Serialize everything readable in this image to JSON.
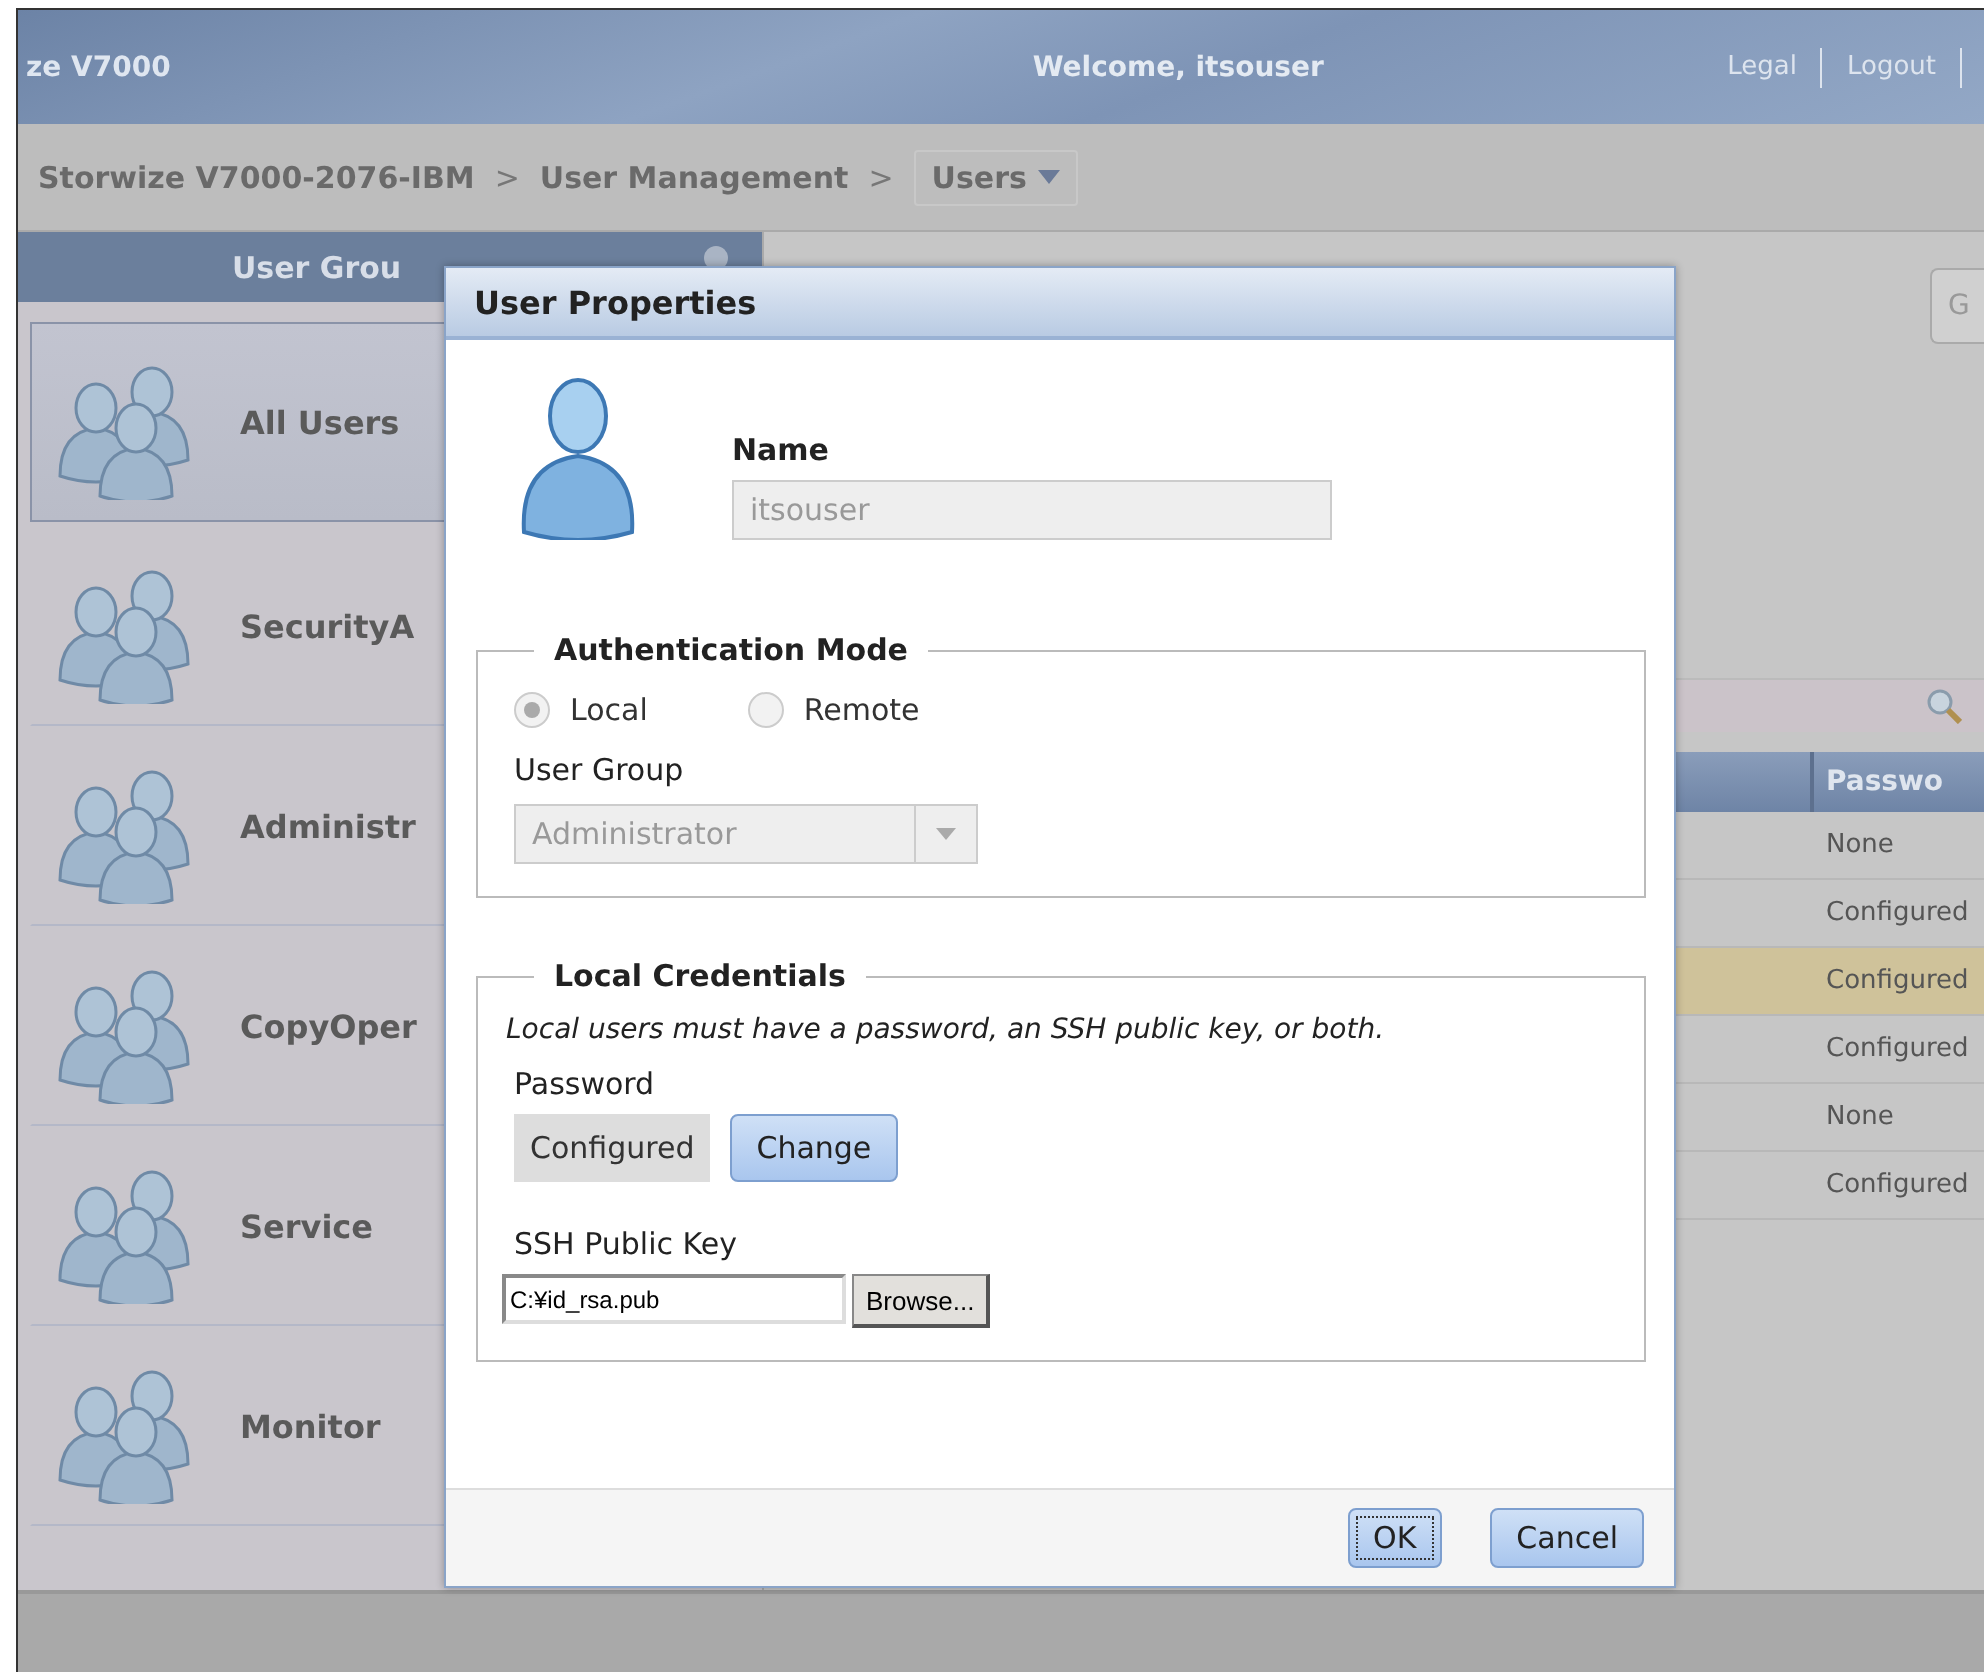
{
  "header": {
    "product": "ze V7000",
    "welcome": "Welcome, itsouser",
    "links": [
      "Legal",
      "Logout"
    ]
  },
  "breadcrumb": {
    "items": [
      "Storwize V7000-2076-IBM",
      "User Management"
    ],
    "separator": ">",
    "current": "Users"
  },
  "sidebar": {
    "title": "User Grou",
    "groups": [
      {
        "label": "All Users",
        "selected": true
      },
      {
        "label": "SecurityA",
        "selected": false
      },
      {
        "label": "Administr",
        "selected": false
      },
      {
        "label": "CopyOper",
        "selected": false
      },
      {
        "label": "Service",
        "selected": false
      },
      {
        "label": "Monitor",
        "selected": false
      }
    ]
  },
  "toolbar": {
    "button": "G"
  },
  "table": {
    "columns": [
      "Passwo"
    ],
    "rows": [
      {
        "password": "None",
        "selected": false
      },
      {
        "password": "Configured",
        "selected": false
      },
      {
        "password": "Configured",
        "selected": true
      },
      {
        "password": "Configured",
        "selected": false
      },
      {
        "password": "None",
        "selected": false
      },
      {
        "password": "Configured",
        "selected": false
      }
    ]
  },
  "dialog": {
    "title": "User Properties",
    "name": {
      "label": "Name",
      "value": "itsouser",
      "disabled": true
    },
    "auth": {
      "legend": "Authentication Mode",
      "modes": [
        {
          "label": "Local",
          "selected": true
        },
        {
          "label": "Remote",
          "selected": false
        }
      ],
      "group_label": "User Group",
      "group_value": "Administrator",
      "disabled": true
    },
    "credentials": {
      "legend": "Local Credentials",
      "note": "Local users must have a password, an SSH public key, or both.",
      "password_label": "Password",
      "password_status": "Configured",
      "change_button": "Change",
      "ssh_label": "SSH Public Key",
      "ssh_value": "C:¥id_rsa.pub",
      "browse_button": "Browse..."
    },
    "buttons": [
      {
        "label": "OK",
        "focused": true
      },
      {
        "label": "Cancel",
        "focused": false
      }
    ]
  }
}
